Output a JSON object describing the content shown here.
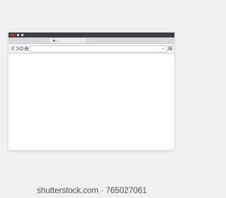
{
  "browser": {
    "window_buttons": [
      "close",
      "minimize",
      "maximize"
    ],
    "tab": {
      "icon": "page-icon",
      "close_icon": "close-icon"
    },
    "toolbar": {
      "icons": [
        "back-arrow-icon",
        "forward-arrow-icon",
        "reload-icon",
        "home-icon"
      ],
      "url_value": "",
      "url_icons": [
        "star-icon",
        "dropdown-icon"
      ],
      "menu_icon": "hamburger-menu-icon"
    },
    "colors": {
      "titlebar": "#3b3e45",
      "close_button": "#d9302f",
      "tabstrip": "#d7d8da",
      "toolbar": "#f2f2f3",
      "background": "#f0f0f0"
    }
  },
  "watermark": {
    "text": "shutterstock.com · 765027061"
  }
}
